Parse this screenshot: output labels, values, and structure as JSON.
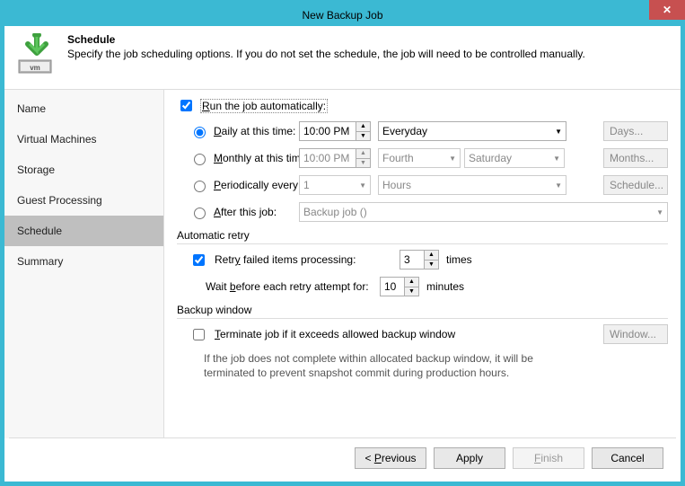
{
  "window": {
    "title": "New Backup Job"
  },
  "header": {
    "title": "Schedule",
    "desc": "Specify the job scheduling options. If you do not set the schedule, the job will need to be controlled manually."
  },
  "sidebar": {
    "items": [
      {
        "label": "Name"
      },
      {
        "label": "Virtual Machines"
      },
      {
        "label": "Storage"
      },
      {
        "label": "Guest Processing"
      },
      {
        "label": "Schedule",
        "active": true
      },
      {
        "label": "Summary"
      }
    ]
  },
  "schedule": {
    "run_auto_label_pre": "R",
    "run_auto_label_post": "un the job automatically:",
    "run_auto_checked": true,
    "daily": {
      "label_pre": "D",
      "label_post": "aily at this time:",
      "selected": true,
      "time": "10:00 PM",
      "day": "Everyday",
      "btn": "Days..."
    },
    "monthly": {
      "label_pre": "M",
      "label_post": "onthly at this time:",
      "selected": false,
      "time": "10:00 PM",
      "ordinal": "Fourth",
      "weekday": "Saturday",
      "btn": "Months..."
    },
    "periodic": {
      "label_pre": "P",
      "label_post": "eriodically every:",
      "selected": false,
      "value": "1",
      "unit": "Hours",
      "btn": "Schedule..."
    },
    "after": {
      "label_pre": "A",
      "label_post": "fter this job:",
      "selected": false,
      "job": "Backup job ()"
    }
  },
  "retry": {
    "section": "Automatic retry",
    "enable_pre": "Retr",
    "enable_u": "y",
    "enable_post": " failed items processing:",
    "checked": true,
    "count": "3",
    "times": "times",
    "wait_pre": "Wait ",
    "wait_u": "b",
    "wait_post": "efore each retry attempt for:",
    "wait_val": "10",
    "minutes": "minutes"
  },
  "bwindow": {
    "section": "Backup window",
    "term_u": "T",
    "term_post": "erminate job if it exceeds allowed backup window",
    "checked": false,
    "btn": "Window...",
    "help": "If the job does not complete within allocated backup window, it will be terminated to prevent snapshot commit during production hours."
  },
  "footer": {
    "prev_pre": "< ",
    "prev_u": "P",
    "prev_post": "revious",
    "apply": "Apply",
    "finish_u": "F",
    "finish_post": "inish",
    "cancel": "Cancel"
  }
}
